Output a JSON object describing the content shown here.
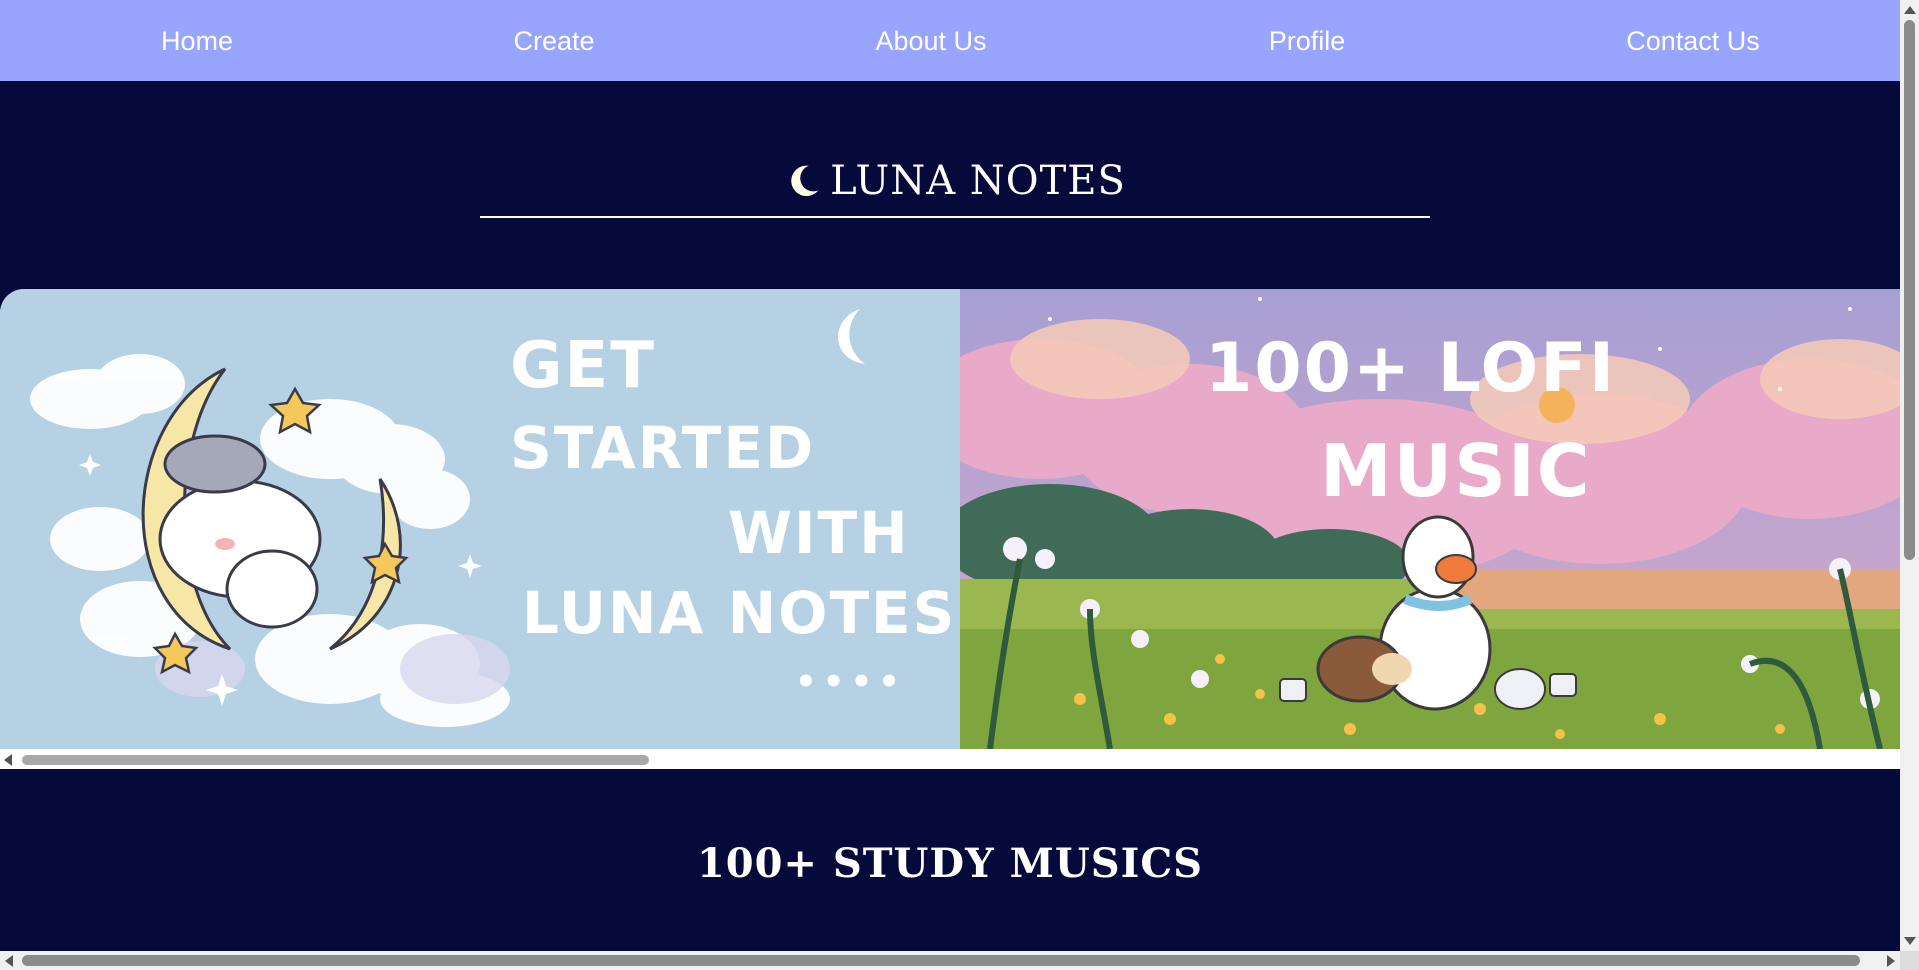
{
  "nav": {
    "items": [
      {
        "label": "Home"
      },
      {
        "label": "Create"
      },
      {
        "label": "About Us"
      },
      {
        "label": "Profile"
      },
      {
        "label": "Contact Us"
      }
    ],
    "background": "#98a5fe"
  },
  "brand": {
    "title": "LUNA NOTES",
    "icon": "crescent-moon-icon"
  },
  "carousel": {
    "slides": [
      {
        "lines": [
          "GET",
          "STARTED",
          "WITH",
          "LUNA NOTES",
          "••••"
        ],
        "background": "#b6d1e3"
      },
      {
        "lines": [
          "100+ LOFI",
          "MUSIC"
        ],
        "background": "#b9a6d8"
      }
    ]
  },
  "section": {
    "title": "100+ STUDY MUSICS"
  },
  "colors": {
    "page_background": "#050a3b",
    "text": "#ffffff"
  }
}
